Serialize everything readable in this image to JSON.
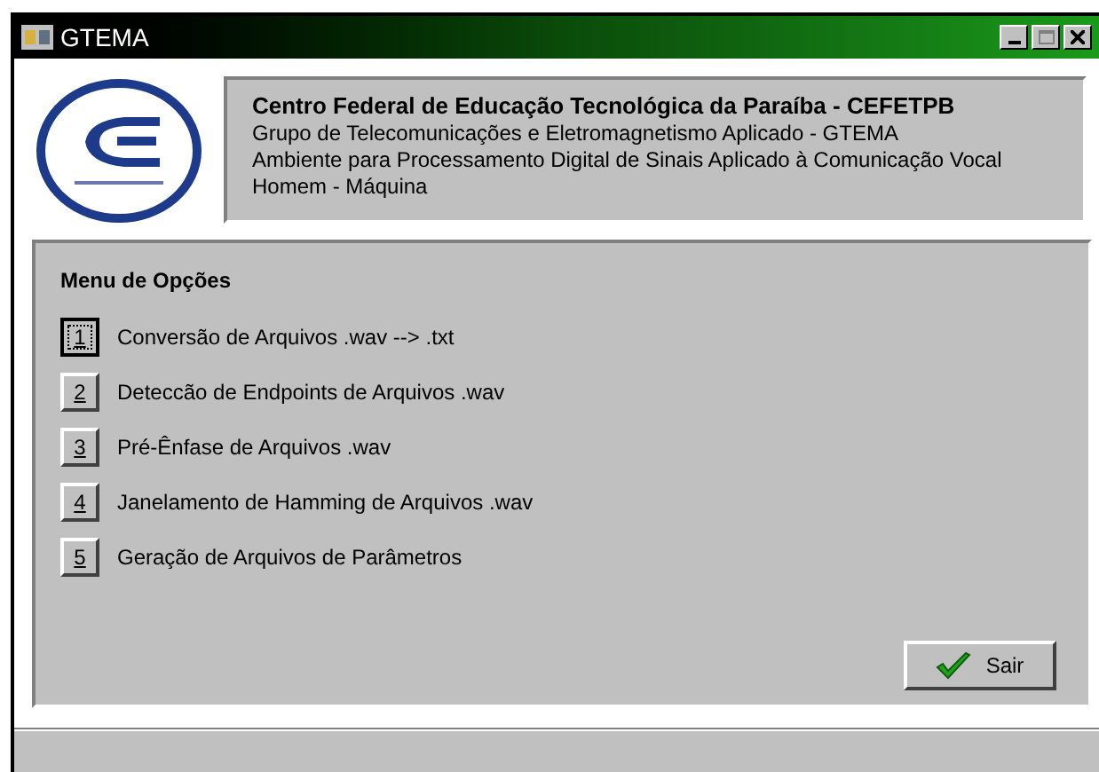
{
  "window": {
    "title": "GTEMA"
  },
  "header": {
    "lines": [
      "Centro Federal de Educação Tecnológica da Paraíba - CEFETPB",
      "Grupo de Telecomunicações e Eletromagnetismo Aplicado - GTEMA",
      "Ambiente para Processamento Digital de Sinais Aplicado à Comunicação Vocal",
      "Homem - Máquina"
    ]
  },
  "menu": {
    "title": "Menu de Opções",
    "options": [
      {
        "key": "1",
        "label": "Conversão de Arquivos .wav --> .txt",
        "focused": true
      },
      {
        "key": "2",
        "label": "Deteccão de Endpoints de Arquivos .wav",
        "focused": false
      },
      {
        "key": "3",
        "label": "Pré-Ênfase de Arquivos .wav",
        "focused": false
      },
      {
        "key": "4",
        "label": "Janelamento de Hamming de Arquivos .wav",
        "focused": false
      },
      {
        "key": "5",
        "label": "Geração de Arquivos de Parâmetros",
        "focused": false
      }
    ]
  },
  "exit_button": {
    "label": "Sair"
  }
}
